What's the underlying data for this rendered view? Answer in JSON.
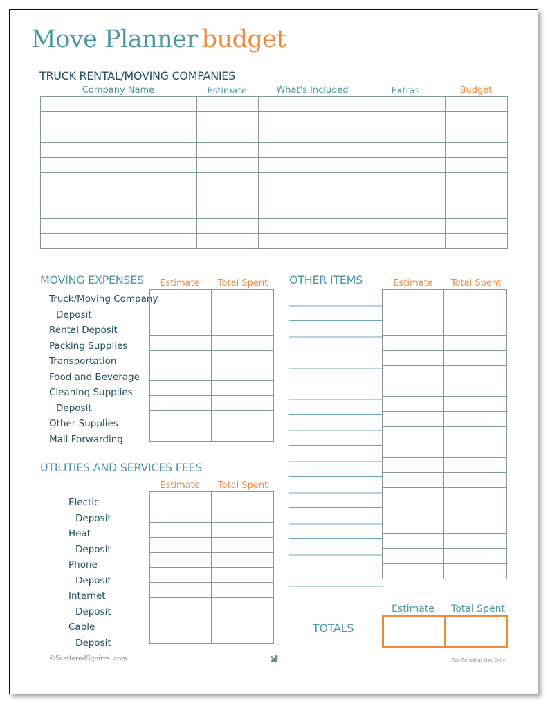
{
  "title": {
    "part1": "Move Planner",
    "part2": "budget"
  },
  "truck_section": {
    "heading": "TRUCK RENTAL/MOVING COMPANIES",
    "columns": [
      "Company Name",
      "Estimate",
      "What's Included",
      "Extras",
      "Budget"
    ],
    "row_count": 10
  },
  "moving_expenses": {
    "heading": "MOVING EXPENSES",
    "columns": [
      "Estimate",
      "Total Spent"
    ],
    "rows": [
      {
        "label": "Truck/Moving Company",
        "indent": false
      },
      {
        "label": "Deposit",
        "indent": true
      },
      {
        "label": "Rental Deposit",
        "indent": false
      },
      {
        "label": "Packing Supplies",
        "indent": false
      },
      {
        "label": "Transportation",
        "indent": false
      },
      {
        "label": "Food and Beverage",
        "indent": false
      },
      {
        "label": "Cleaning Supplies",
        "indent": false
      },
      {
        "label": "Deposit",
        "indent": true
      },
      {
        "label": "Other Supplies",
        "indent": false
      },
      {
        "label": "Mail Forwarding",
        "indent": false
      }
    ]
  },
  "utilities": {
    "heading": "UTILITIES AND SERVICES FEES",
    "columns": [
      "Estimate",
      "Total Spent"
    ],
    "rows": [
      {
        "label": "Electic",
        "indent": false
      },
      {
        "label": "Deposit",
        "indent": true
      },
      {
        "label": "Heat",
        "indent": false
      },
      {
        "label": "Deposit",
        "indent": true
      },
      {
        "label": "Phone",
        "indent": false
      },
      {
        "label": "Deposit",
        "indent": true
      },
      {
        "label": "Internet",
        "indent": false
      },
      {
        "label": "Deposit",
        "indent": true
      },
      {
        "label": "Cable",
        "indent": false
      },
      {
        "label": "Deposit",
        "indent": true
      }
    ]
  },
  "other_items": {
    "heading": "OTHER ITEMS",
    "columns": [
      "Estimate",
      "Total Spent"
    ],
    "row_count": 19
  },
  "totals": {
    "label": "TOTALS",
    "columns": [
      "Estimate",
      "Total Spent"
    ]
  },
  "footer": {
    "copyright": "©ScatteredSquirrel.com",
    "logo_icon": "squirrel-icon",
    "note": "For Personal Use Only"
  },
  "colors": {
    "teal": "#4a95a3",
    "navy": "#1e4f63",
    "orange": "#ec8a3c",
    "grid": "#7f9a96"
  }
}
